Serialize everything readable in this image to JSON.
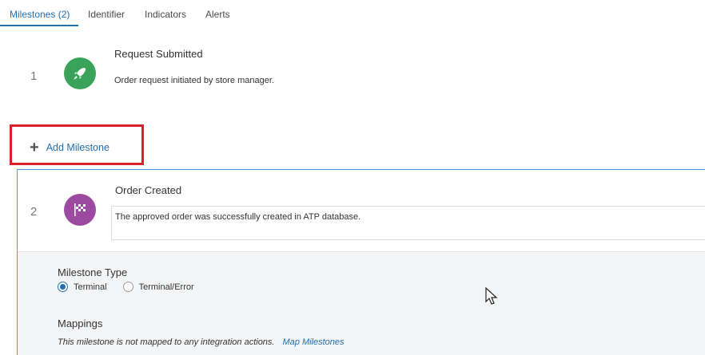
{
  "tabs": [
    {
      "label": "Milestones (2)",
      "active": true
    },
    {
      "label": "Identifier",
      "active": false
    },
    {
      "label": "Indicators",
      "active": false
    },
    {
      "label": "Alerts",
      "active": false
    }
  ],
  "milestones": [
    {
      "number": "1",
      "title": "Request Submitted",
      "description": "Order request initiated by store manager.",
      "icon": "rocket-icon",
      "icon_color": "#3aa35a"
    },
    {
      "number": "2",
      "title": "Order Created",
      "description": "The approved order was successfully created in ATP database.",
      "icon": "checkered-flag-icon",
      "icon_color": "#9b4aa0"
    }
  ],
  "add_milestone": {
    "label": "Add Milestone",
    "icon": "plus-icon"
  },
  "details": {
    "milestone_type_label": "Milestone Type",
    "type_options": [
      {
        "label": "Terminal",
        "checked": true
      },
      {
        "label": "Terminal/Error",
        "checked": false
      }
    ],
    "mappings_label": "Mappings",
    "mapping_note": "This milestone is not mapped to any integration actions.",
    "map_link": "Map Milestones"
  },
  "colors": {
    "accent": "#1f6fb2",
    "highlight_box": "#e0202a"
  }
}
